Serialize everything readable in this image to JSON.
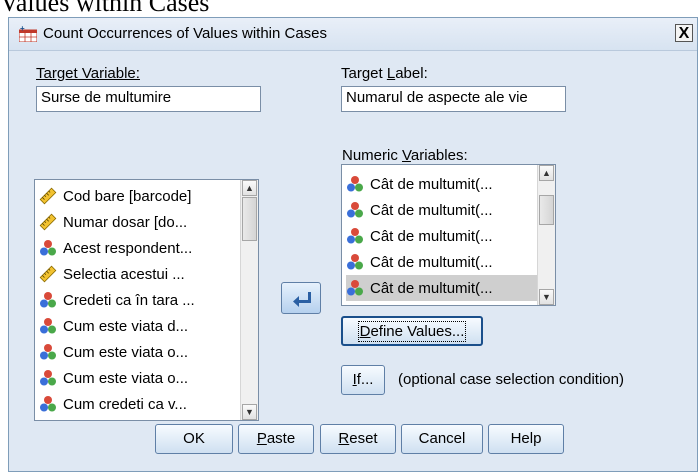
{
  "background_text": "Values within Cases",
  "dialog": {
    "title": "Count Occurrences of Values within Cases",
    "close_glyph": "X"
  },
  "target_variable": {
    "label": "Target Variable:",
    "value": "Surse de multumire"
  },
  "target_label": {
    "label_pre": "Target ",
    "label_underline": "L",
    "label_post": "abel:",
    "value": "Numarul de aspecte ale vie"
  },
  "source_list": {
    "items": [
      {
        "label": "Cod bare [barcode]",
        "icon": "ruler-icon"
      },
      {
        "label": "Numar dosar [do...",
        "icon": "ruler-icon"
      },
      {
        "label": "Acest respondent...",
        "icon": "nominal-icon"
      },
      {
        "label": "Selectia acestui ...",
        "icon": "ruler-icon"
      },
      {
        "label": "Credeti ca în tara ...",
        "icon": "nominal-icon"
      },
      {
        "label": "Cum este viata d...",
        "icon": "nominal-icon"
      },
      {
        "label": "Cum este viata o...",
        "icon": "nominal-icon"
      },
      {
        "label": "Cum este viata o...",
        "icon": "nominal-icon"
      },
      {
        "label": "Cum credeti ca v...",
        "icon": "nominal-icon"
      }
    ]
  },
  "numeric_variables": {
    "label_pre": "Numeric ",
    "label_underline": "V",
    "label_post": "ariables:",
    "items": [
      {
        "label": "Cât de multumit(...",
        "icon": "nominal-icon"
      },
      {
        "label": "Cât de multumit(...",
        "icon": "nominal-icon"
      },
      {
        "label": "Cât de multumit(...",
        "icon": "nominal-icon"
      },
      {
        "label": "Cât de multumit(...",
        "icon": "nominal-icon"
      },
      {
        "label": "Cât de multumit(...",
        "icon": "nominal-icon",
        "selected": true
      }
    ]
  },
  "define_values_button": {
    "u": "D",
    "rest": "efine Values..."
  },
  "if_button": {
    "u": "I",
    "rest": "f..."
  },
  "if_hint": "(optional case selection condition)",
  "buttons": {
    "ok": "OK",
    "paste_u": "P",
    "paste_rest": "aste",
    "reset_u": "R",
    "reset_rest": "eset",
    "cancel": "Cancel",
    "help": "Help"
  }
}
